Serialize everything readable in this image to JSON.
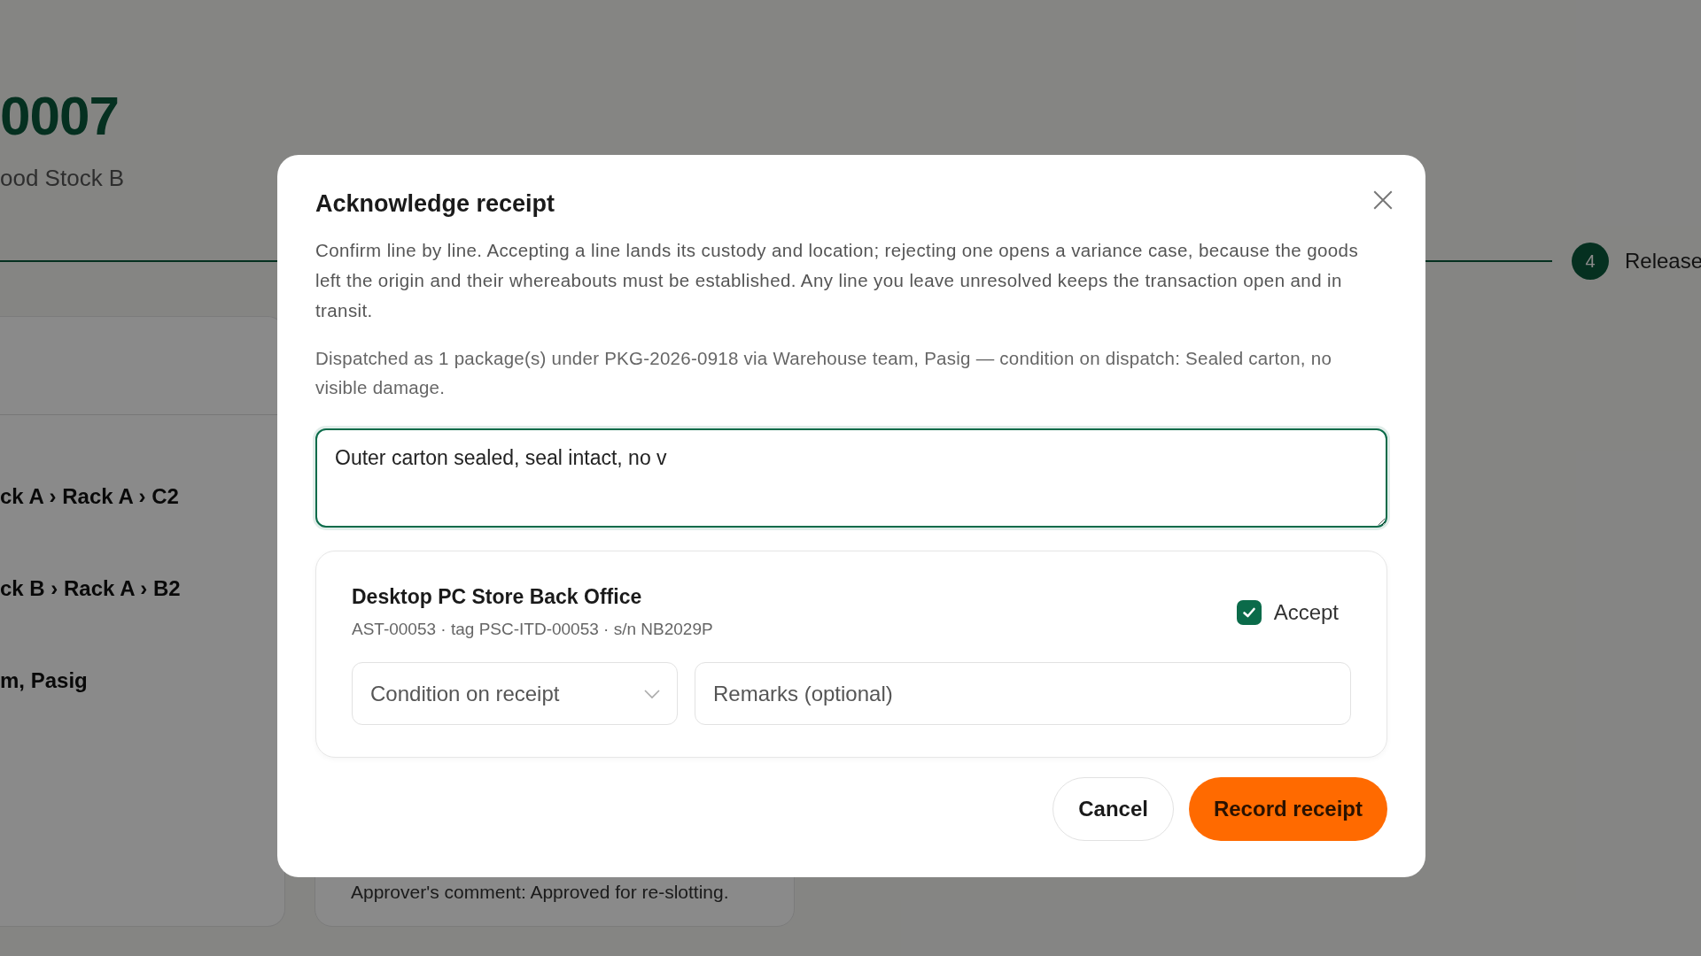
{
  "page": {
    "title": "0007",
    "subtitle": "ood Stock B",
    "stepper": {
      "number": "4",
      "label": "Release"
    },
    "location_rows": [
      "ck A › Rack A › C2",
      "ck B › Rack A › B2",
      "m, Pasig"
    ],
    "comment": "Approver's comment: Approved for re-slotting."
  },
  "dialog": {
    "title": "Acknowledge receipt",
    "description": "Confirm line by line. Accepting a line lands its custody and location; rejecting one opens a variance case, because the goods left the origin and their whereabouts must be established. Any line you leave unresolved keeps the transaction open and in transit.",
    "dispatch_note": "Dispatched as 1 package(s) under PKG-2026-0918 via Warehouse team, Pasig — condition on dispatch: Sealed carton, no visible damage.",
    "note_field": {
      "value": "Outer carton sealed, seal intact, no v"
    },
    "lines": [
      {
        "name": "Desktop PC Store Back Office",
        "details": "AST-00053 · tag PSC-ITD-00053 · s/n NB2029P",
        "accept": {
          "label": "Accept",
          "checked": true
        },
        "condition": {
          "placeholder": "Condition on receipt"
        },
        "remarks": {
          "placeholder": "Remarks (optional)"
        }
      }
    ],
    "buttons": [
      {
        "label": "Cancel",
        "kind": "secondary"
      },
      {
        "label": "Record receipt",
        "kind": "primary"
      }
    ]
  }
}
